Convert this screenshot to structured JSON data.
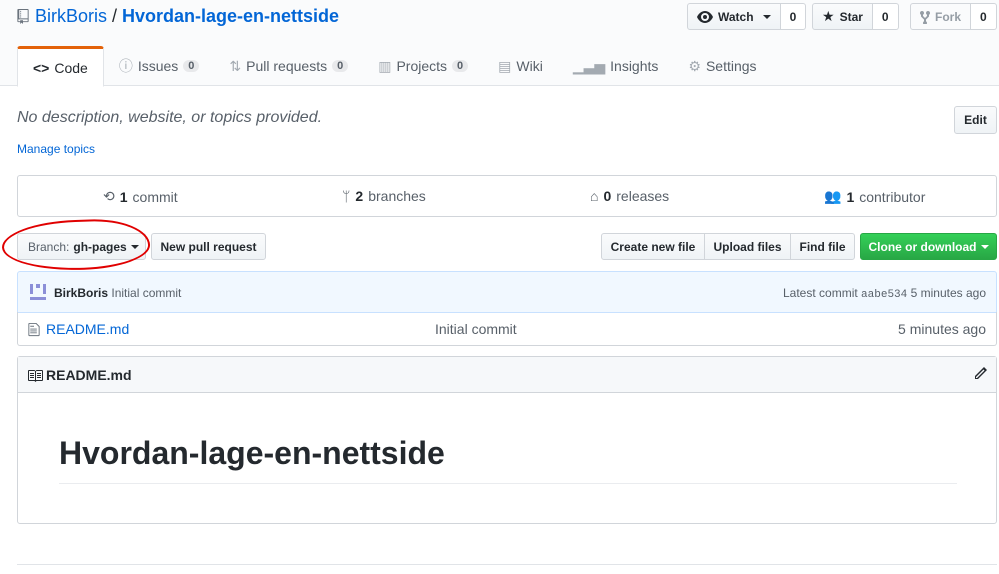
{
  "repo": {
    "owner": "BirkBoris",
    "separator": "/",
    "name": "Hvordan-lage-en-nettside"
  },
  "social": {
    "watch_label": "Watch",
    "watch_count": "0",
    "star_label": "Star",
    "star_count": "0",
    "fork_label": "Fork",
    "fork_count": "0"
  },
  "tabs": [
    {
      "label": "Code",
      "icon": "code-icon",
      "selected": true
    },
    {
      "label": "Issues",
      "icon": "issue-icon",
      "counter": "0"
    },
    {
      "label": "Pull requests",
      "icon": "pull-request-icon",
      "counter": "0"
    },
    {
      "label": "Projects",
      "icon": "project-icon",
      "counter": "0"
    },
    {
      "label": "Wiki",
      "icon": "book-icon"
    },
    {
      "label": "Insights",
      "icon": "graph-icon"
    },
    {
      "label": "Settings",
      "icon": "gear-icon"
    }
  ],
  "description": {
    "text": "No description, website, or topics provided.",
    "manage_topics": "Manage topics",
    "edit_label": "Edit"
  },
  "numbers": {
    "commits_count": "1",
    "commits_label": "commit",
    "branches_count": "2",
    "branches_label": "branches",
    "releases_count": "0",
    "releases_label": "releases",
    "contributors_count": "1",
    "contributors_label": "contributor"
  },
  "branch": {
    "prefix": "Branch:",
    "value": "gh-pages",
    "new_pull_request": "New pull request"
  },
  "file_nav": {
    "create_new_file": "Create new file",
    "upload_files": "Upload files",
    "find_file": "Find file",
    "clone_or_download": "Clone or download"
  },
  "commit": {
    "author": "BirkBoris",
    "message": "Initial commit",
    "latest_label": "Latest commit",
    "sha": "aabe534",
    "age": "5 minutes ago"
  },
  "files": [
    {
      "name": "README.md",
      "message": "Initial commit",
      "age": "5 minutes ago"
    }
  ],
  "readme": {
    "filename": "README.md",
    "heading": "Hvordan-lage-en-nettside"
  },
  "colors": {
    "link": "#0366d6",
    "accent_tab": "#e36209",
    "clone_green": "#28a745",
    "annotation_red": "#e00000"
  }
}
